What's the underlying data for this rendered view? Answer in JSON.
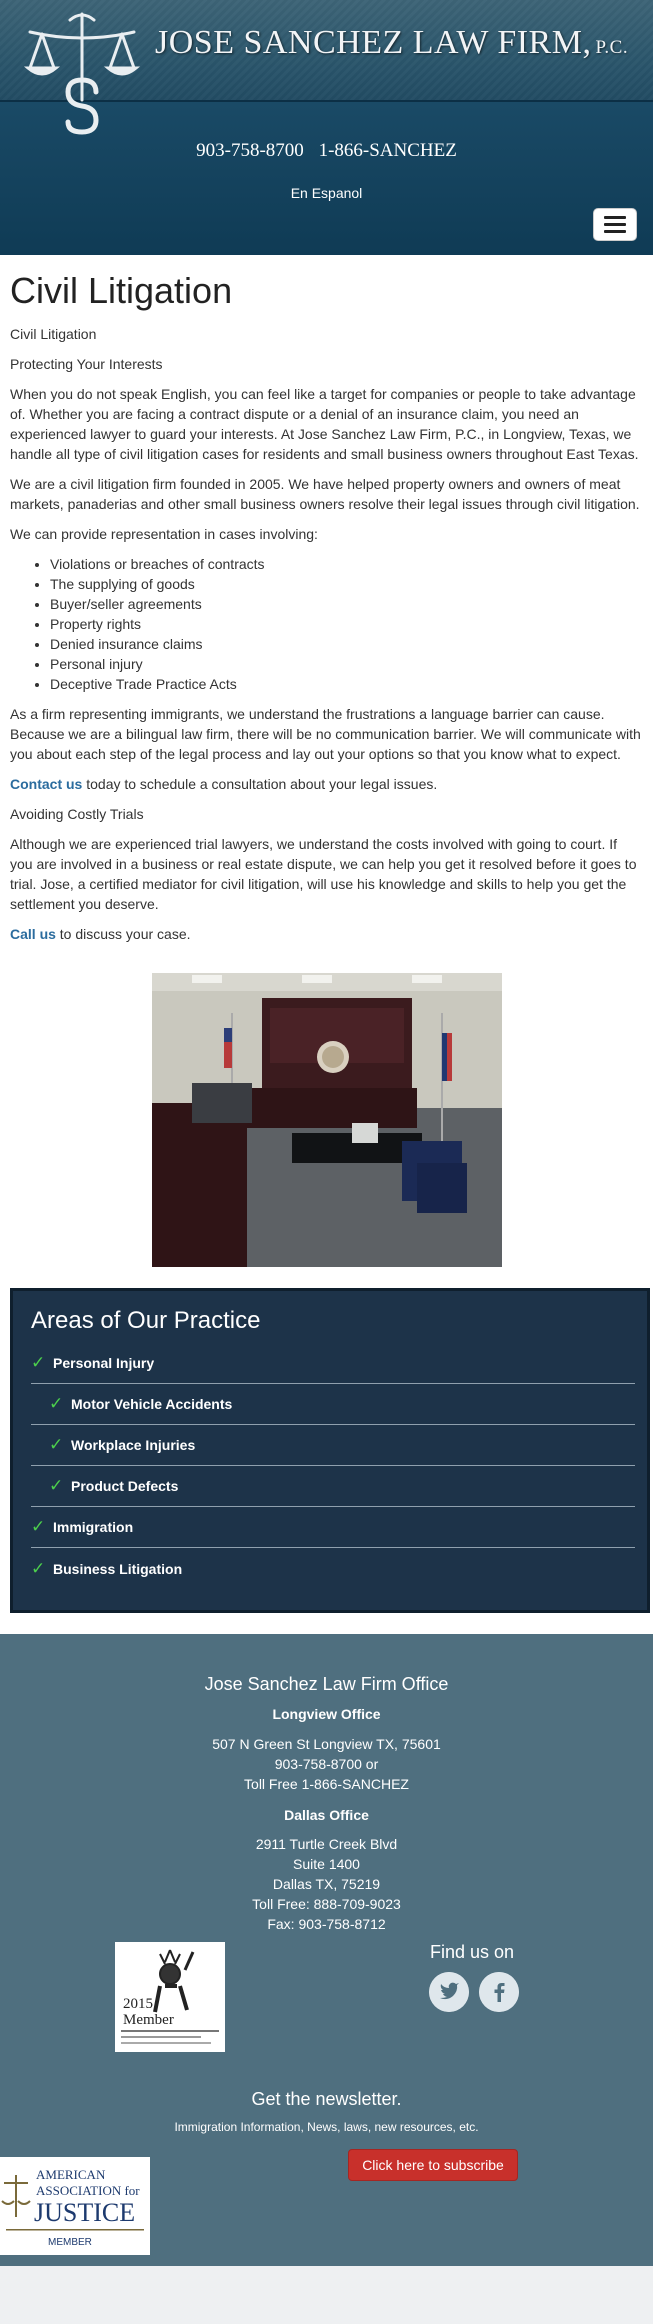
{
  "header": {
    "firm_name": "JOSE SANCHEZ LAW FIRM,",
    "firm_suffix": "P.C.",
    "phone_local": "903-758-8700",
    "phone_toll": "1-866-SANCHEZ",
    "language_link": "En Espanol",
    "menu_icon": "hamburger-menu-icon"
  },
  "main": {
    "title": "Civil Litigation",
    "breadcrumb": "Civil Litigation",
    "subheading_protect": "Protecting Your Interests",
    "para1": "When you do not speak English, you can feel like a target for companies or people to take advantage of. Whether you are facing a contract dispute or a denial of an insurance claim, you need an experienced lawyer to guard your interests. At Jose Sanchez Law Firm, P.C., in Longview, Texas, we handle all type of civil litigation cases for residents and small business owners throughout East Texas.",
    "para2": "We are a civil litigation firm founded in 2005. We have helped property owners and owners of meat markets, panaderias and other small business owners resolve their legal issues through civil litigation.",
    "para3": "We can provide representation in cases involving:",
    "list": [
      "Violations or breaches of contracts",
      "The supplying of goods",
      "Buyer/seller agreements",
      "Property rights",
      "Denied insurance claims",
      "Personal injury",
      "Deceptive Trade Practice Acts"
    ],
    "para4": "As a firm representing immigrants, we understand the frustrations a language barrier can cause. Because we are a bilingual law firm, there will be no communication barrier. We will communicate with you about each step of the legal process and lay out your options so that you know what to expect.",
    "contact_link": "Contact us",
    "contact_rest": " today to schedule a consultation about your legal issues.",
    "subheading_trials": "Avoiding Costly Trials",
    "para5": "Although we are experienced trial lawyers, we understand the costs involved with going to court. If you are involved in a business or real estate dispute, we can help you get it resolved before it goes to trial. Jose, a certified mediator for civil litigation, will use his knowledge and skills to help you get the settlement you deserve.",
    "call_link": "Call us",
    "call_rest": " to discuss your case."
  },
  "practice": {
    "title": "Areas of Our Practice",
    "items": [
      {
        "label": "Personal Injury",
        "sub": false
      },
      {
        "label": "Motor Vehicle Accidents",
        "sub": true
      },
      {
        "label": "Workplace Injuries",
        "sub": true
      },
      {
        "label": "Product Defects",
        "sub": true
      },
      {
        "label": "Immigration",
        "sub": false
      },
      {
        "label": "Business Litigation",
        "sub": false
      }
    ],
    "check_color": "#4ccf4c"
  },
  "footer": {
    "title": "Jose Sanchez Law Firm Office",
    "longview_heading": "Longview Office",
    "longview_address": "507 N Green St Longview TX, 75601",
    "longview_phone": "903-758-8700 or",
    "longview_toll": "Toll Free 1-866-SANCHEZ",
    "dallas_heading": "Dallas Office",
    "dallas_street": "2911 Turtle Creek Blvd",
    "dallas_suite": "Suite 1400",
    "dallas_city": "Dallas TX, 75219",
    "dallas_toll": "Toll Free: 888-709-9023",
    "dallas_fax": "Fax: 903-758-8712",
    "member_year": "2015",
    "member_word": "Member",
    "find_us": "Find us on",
    "newsletter_title": "Get the newsletter.",
    "newsletter_sub": "Immigration Information, News, laws, new resources, etc.",
    "subscribe_label": "Click here to subscribe",
    "aaj_line1": "AMERICAN",
    "aaj_line2": "ASSOCIATION for",
    "aaj_line3": "JUSTICE",
    "aaj_member": "MEMBER",
    "bg_color": "#4f6f7f",
    "subscribe_color": "#c8302b"
  }
}
